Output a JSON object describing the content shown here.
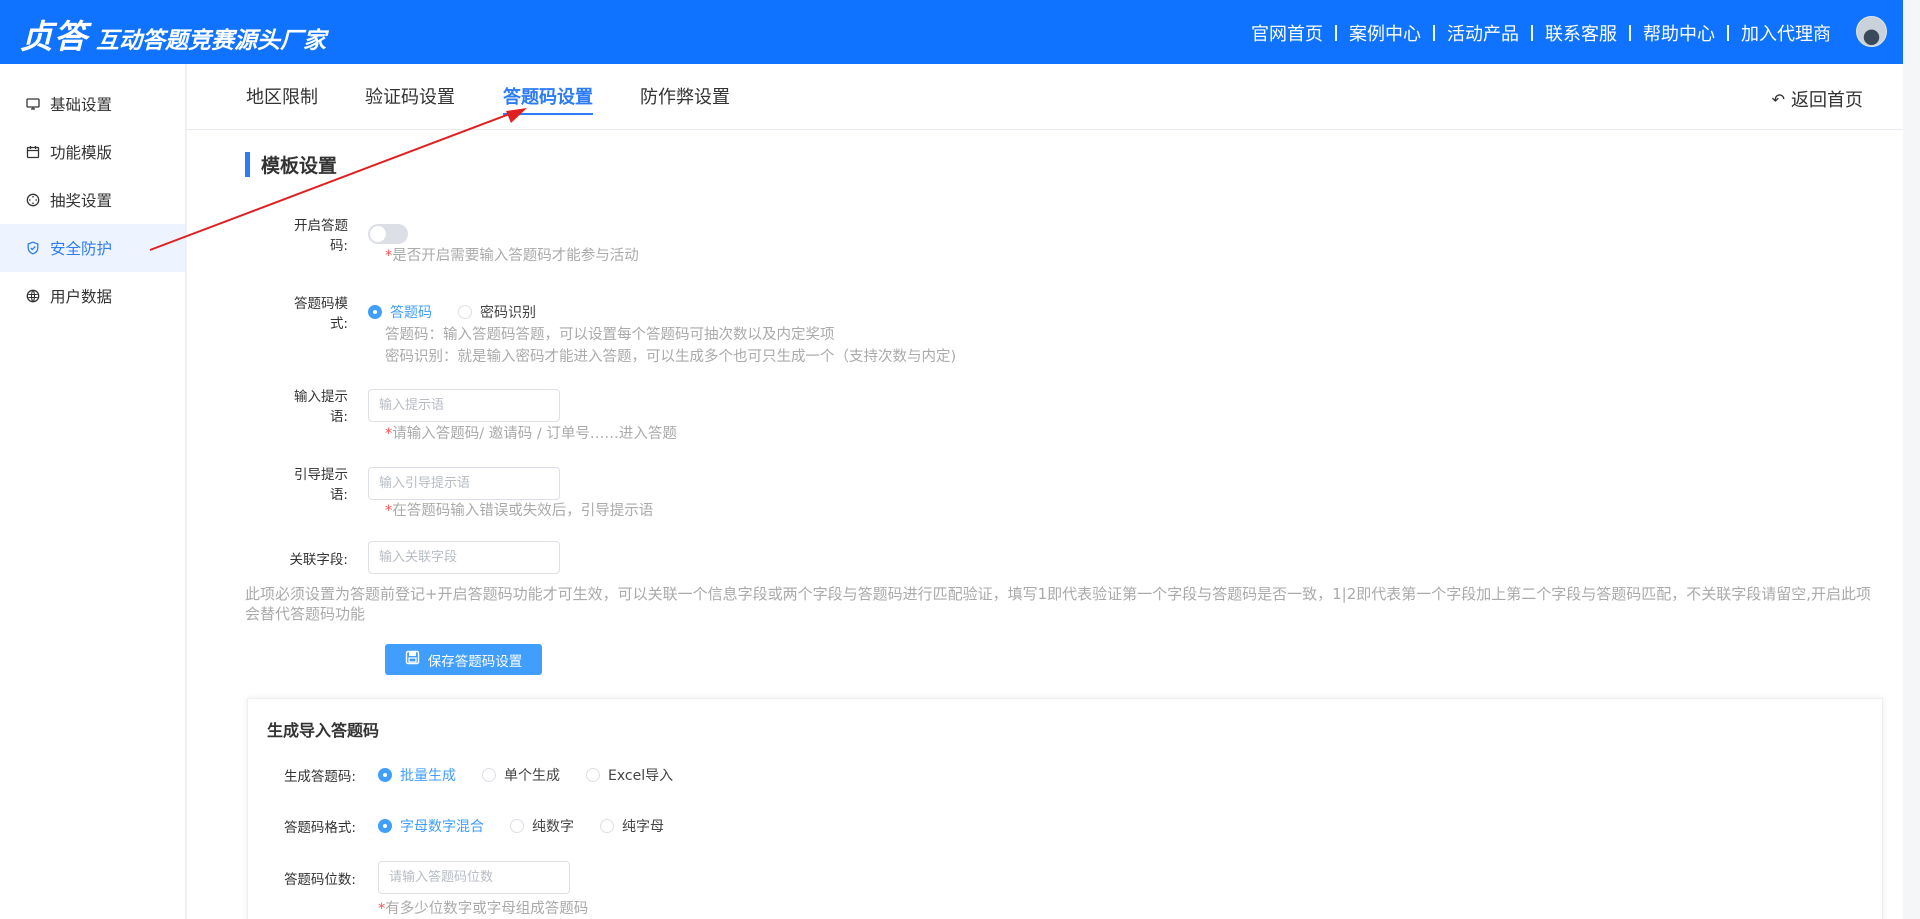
{
  "header": {
    "logo_main": "贞答",
    "logo_sub": "互动答题竞赛源头厂家",
    "nav": [
      {
        "label": "官网首页"
      },
      {
        "label": "案例中心"
      },
      {
        "label": "活动产品"
      },
      {
        "label": "联系客服"
      },
      {
        "label": "帮助中心"
      },
      {
        "label": "加入代理商"
      }
    ]
  },
  "sidebar": {
    "items": [
      {
        "label": "基础设置",
        "icon": "monitor-icon"
      },
      {
        "label": "功能模版",
        "icon": "calendar-icon"
      },
      {
        "label": "抽奖设置",
        "icon": "compass-icon"
      },
      {
        "label": "安全防护",
        "icon": "shield-icon",
        "active": true
      },
      {
        "label": "用户数据",
        "icon": "globe-icon"
      }
    ]
  },
  "tabs": [
    {
      "label": "地区限制"
    },
    {
      "label": "验证码设置"
    },
    {
      "label": "答题码设置",
      "active": true
    },
    {
      "label": "防作弊设置"
    }
  ],
  "back_label": "返回首页",
  "section_title": "模板设置",
  "form": {
    "enable_label": "开启答题码:",
    "enable_hint_req": "*",
    "enable_hint": "是否开启需要输入答题码才能参与活动",
    "mode_label": "答题码模式:",
    "mode_options": [
      "答题码",
      "密码识别"
    ],
    "mode_selected": "答题码",
    "mode_desc_1": "答题码：输入答题码答题，可以设置每个答题码可抽次数以及内定奖项",
    "mode_desc_2": "密码识别：就是输入密码才能进入答题，可以生成多个也可只生成一个（支持次数与内定)",
    "input_tip_label": "输入提示语:",
    "input_tip_placeholder": "输入提示语",
    "input_tip_hint_req": "*",
    "input_tip_hint": "请输入答题码/ 邀请码 / 订单号……进入答题",
    "guide_label": "引导提示语:",
    "guide_placeholder": "输入引导提示语",
    "guide_hint_req": "*",
    "guide_hint": "在答题码输入错误或失效后，引导提示语",
    "field_label": "关联字段:",
    "field_placeholder": "输入关联字段",
    "note": "此项必须设置为答题前登记+开启答题码功能才可生效，可以关联一个信息字段或两个字段与答题码进行匹配验证，填写1即代表验证第一个字段与答题码是否一致，1|2即代表第一个字段加上第二个字段与答题码匹配，不关联字段请留空,开启此项会替代答题码功能",
    "save_label": "保存答题码设置"
  },
  "generate": {
    "title": "生成导入答题码",
    "gen_label": "生成答题码:",
    "gen_options": [
      "批量生成",
      "单个生成",
      "Excel导入"
    ],
    "gen_selected": "批量生成",
    "format_label": "答题码格式:",
    "format_options": [
      "字母数字混合",
      "纯数字",
      "纯字母"
    ],
    "format_selected": "字母数字混合",
    "digits_label": "答题码位数:",
    "digits_placeholder": "请输入答题码位数",
    "digits_hint_req": "*",
    "digits_hint": "有多少位数字或字母组成答题码"
  },
  "colors": {
    "brand": "#0f73ff",
    "accent": "#2d7cf6",
    "radio": "#409eff",
    "annotation": "#e02020"
  }
}
